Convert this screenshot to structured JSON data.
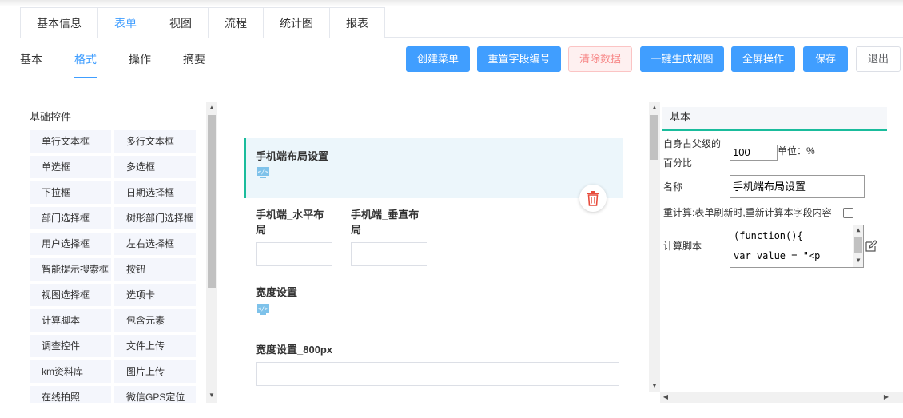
{
  "main_tabs": [
    {
      "label": "基本信息",
      "active": false
    },
    {
      "label": "表单",
      "active": true
    },
    {
      "label": "视图",
      "active": false
    },
    {
      "label": "流程",
      "active": false
    },
    {
      "label": "统计图",
      "active": false
    },
    {
      "label": "报表",
      "active": false
    }
  ],
  "sub_tabs": [
    {
      "label": "基本",
      "active": false
    },
    {
      "label": "格式",
      "active": true
    },
    {
      "label": "操作",
      "active": false
    },
    {
      "label": "摘要",
      "active": false
    }
  ],
  "toolbar": {
    "create_menu": "创建菜单",
    "reset_field_no": "重置字段编号",
    "clear_data": "清除数据",
    "gen_view": "一键生成视图",
    "fullscreen": "全屏操作",
    "save": "保存",
    "exit": "退出"
  },
  "palette": {
    "title": "基础控件",
    "items": [
      "单行文本框",
      "多行文本框",
      "单选框",
      "多选框",
      "下拉框",
      "日期选择框",
      "部门选择框",
      "树形部门选择框",
      "用户选择框",
      "左右选择框",
      "智能提示搜索框",
      "按钮",
      "视图选择框",
      "选项卡",
      "计算脚本",
      "包含元素",
      "调查控件",
      "文件上传",
      "km资料库",
      "图片上传",
      "在线拍照",
      "微信GPS定位"
    ]
  },
  "canvas": {
    "mobile_layout_title": "手机端布局设置",
    "mobile_h_label_1": "手机端_水平布",
    "mobile_h_label_2": "局",
    "mobile_v_label_1": "手机端_垂直布",
    "mobile_v_label_2": "局",
    "width_setting_title": "宽度设置",
    "width_800_label": "宽度设置_800px"
  },
  "props": {
    "header": "基本",
    "percent_label_1": "自身占父级的",
    "percent_label_2": "百分比",
    "percent_value": "100",
    "unit_label": "单位：%",
    "name_label": "名称",
    "name_value": "手机端布局设置",
    "recalc_label": "重计算:表单刷新时,重新计算本字段内容",
    "script_label": "计算脚本",
    "script_line_1": "(function(){",
    "script_line_2": "var value = \"<p"
  },
  "colors": {
    "primary": "#409eff",
    "accent_teal": "#1abc9c",
    "danger": "#f78989",
    "palette_bg": "#f4f6fc"
  }
}
